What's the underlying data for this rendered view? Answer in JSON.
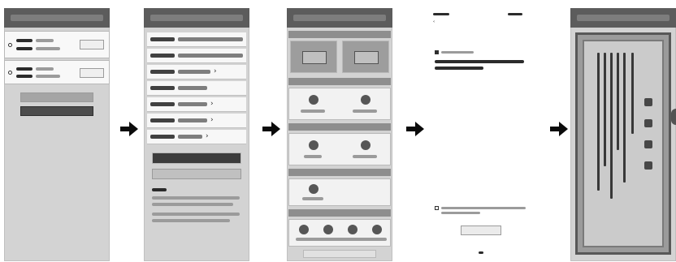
{
  "panels": [
    {
      "id": "screen-1"
    },
    {
      "id": "screen-2"
    },
    {
      "id": "screen-3"
    },
    {
      "id": "screen-4"
    },
    {
      "id": "screen-5"
    }
  ],
  "arrow_icon": "right-arrow-icon"
}
